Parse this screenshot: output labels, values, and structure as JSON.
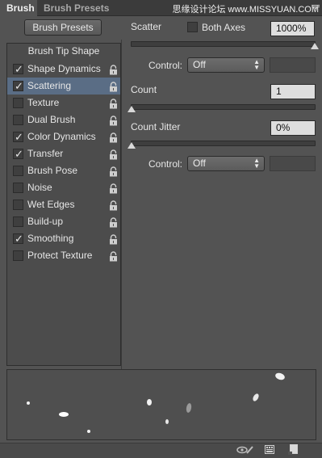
{
  "tabs": [
    {
      "label": "Brush"
    },
    {
      "label": "Brush Presets"
    }
  ],
  "watermark": "思缘设计论坛 www.MISSYUAN.COM",
  "brush_presets_button": "Brush Presets",
  "brush_tip_shape": "Brush Tip Shape",
  "options": [
    {
      "label": "Shape Dynamics",
      "checked": true,
      "selected": false,
      "lock": true
    },
    {
      "label": "Scattering",
      "checked": true,
      "selected": true,
      "lock": true
    },
    {
      "label": "Texture",
      "checked": false,
      "selected": false,
      "lock": true
    },
    {
      "label": "Dual Brush",
      "checked": false,
      "selected": false,
      "lock": true
    },
    {
      "label": "Color Dynamics",
      "checked": true,
      "selected": false,
      "lock": true
    },
    {
      "label": "Transfer",
      "checked": true,
      "selected": false,
      "lock": true
    },
    {
      "label": "Brush Pose",
      "checked": false,
      "selected": false,
      "lock": true
    },
    {
      "label": "Noise",
      "checked": false,
      "selected": false,
      "lock": true
    },
    {
      "label": "Wet Edges",
      "checked": false,
      "selected": false,
      "lock": true
    },
    {
      "label": "Build-up",
      "checked": false,
      "selected": false,
      "lock": true
    },
    {
      "label": "Smoothing",
      "checked": true,
      "selected": false,
      "lock": true
    },
    {
      "label": "Protect Texture",
      "checked": false,
      "selected": false,
      "lock": true
    }
  ],
  "scatter": {
    "label": "Scatter",
    "both_axes_label": "Both Axes",
    "both_axes_checked": false,
    "value": "1000%",
    "slider_fraction": 1.0
  },
  "control1": {
    "label": "Control:",
    "value": "Off"
  },
  "count": {
    "label": "Count",
    "value": "1",
    "slider_fraction": 0.0
  },
  "count_jitter": {
    "label": "Count Jitter",
    "value": "0%",
    "slider_fraction": 0.0
  },
  "control2": {
    "label": "Control:",
    "value": "Off"
  },
  "colors": {
    "panel_bg": "#535353",
    "selected_row": "#5a6d85"
  },
  "icons": {
    "lock": "lock-icon",
    "check": "checkmark-icon",
    "toggle_view": "eye-brush-icon",
    "grid": "grid-icon",
    "new_preset": "new-preset-icon",
    "panel_menu": "panel-menu-icon"
  }
}
